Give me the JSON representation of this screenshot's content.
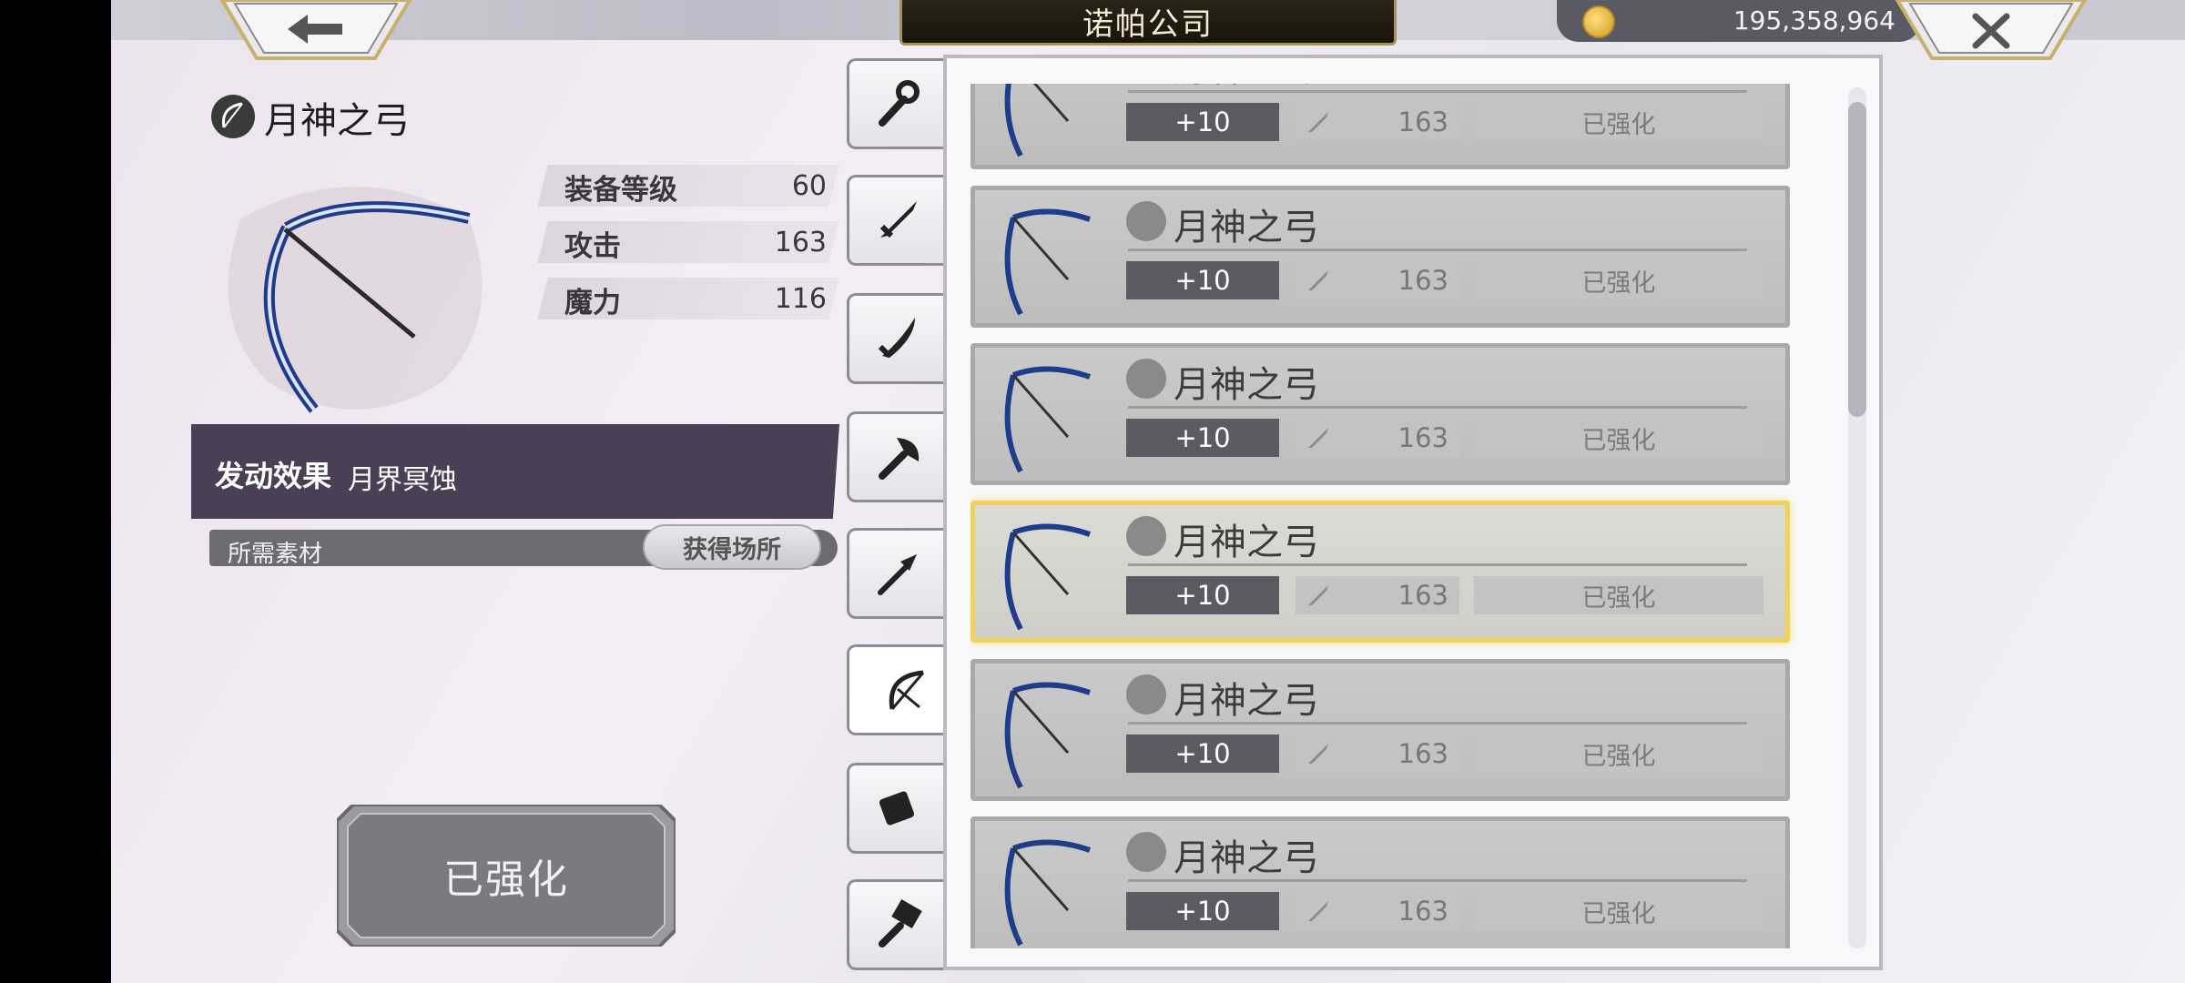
{
  "header": {
    "title": "诺帕公司",
    "currency_value": "195,358,964",
    "back_icon": "arrow-left-icon",
    "close_icon": "close-x-icon",
    "currency_icon": "gold-coin-icon"
  },
  "item": {
    "name": "月神之弓",
    "stats": [
      {
        "label": "装备等级",
        "value": "60"
      },
      {
        "label": "攻击",
        "value": "163"
      },
      {
        "label": "魔力",
        "value": "116"
      }
    ],
    "effect_label": "发动效果",
    "effect_value": "月界冥蚀",
    "materials_label": "所需素材",
    "source_button": "获得场所",
    "main_button": "已强化"
  },
  "tabs": [
    {
      "name": "staff-icon",
      "active": false
    },
    {
      "name": "sword-icon",
      "active": false
    },
    {
      "name": "saber-icon",
      "active": false
    },
    {
      "name": "axe-icon",
      "active": false
    },
    {
      "name": "spear-icon",
      "active": false
    },
    {
      "name": "bow-icon",
      "active": true
    },
    {
      "name": "gauntlet-icon",
      "active": false
    },
    {
      "name": "hammer-icon",
      "active": false
    }
  ],
  "list": {
    "items": [
      {
        "name": "月神之弓",
        "level": "+10",
        "attack": "163",
        "status": "已强化",
        "selected": false
      },
      {
        "name": "月神之弓",
        "level": "+10",
        "attack": "163",
        "status": "已强化",
        "selected": false
      },
      {
        "name": "月神之弓",
        "level": "+10",
        "attack": "163",
        "status": "已强化",
        "selected": false
      },
      {
        "name": "月神之弓",
        "level": "+10",
        "attack": "163",
        "status": "已强化",
        "selected": true
      },
      {
        "name": "月神之弓",
        "level": "+10",
        "attack": "163",
        "status": "已强化",
        "selected": false
      },
      {
        "name": "月神之弓",
        "level": "+10",
        "attack": "163",
        "status": "已强化",
        "selected": false
      }
    ]
  },
  "colors": {
    "accent_gold": "#f2d25a",
    "effect_bar": "#4a3f55",
    "level_badge": "#5d5a63"
  }
}
